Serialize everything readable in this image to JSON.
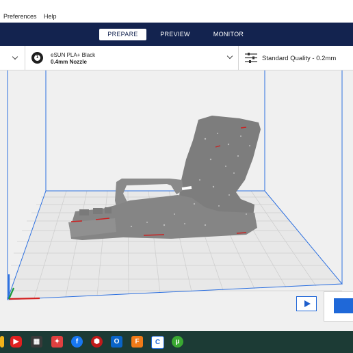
{
  "menu": {
    "preferences": "Preferences",
    "help": "Help"
  },
  "stages": {
    "prepare": "PREPARE",
    "preview": "PREVIEW",
    "monitor": "MONITOR",
    "active": "PREPARE"
  },
  "material": {
    "name": "eSUN PLA+ Black",
    "nozzle": "0.4mm Nozzle",
    "extruder_number": "1"
  },
  "quality": {
    "label": "Standard Quality - 0.2mm"
  },
  "colors": {
    "header_bg": "#13234f",
    "viewport_bg": "#f0f0f0",
    "build_plate": "#e7e7e7",
    "grid_line": "#cfcfcf",
    "volume_edges": "#2b6fe0",
    "model": "#8a8a8a",
    "accent": "#1f68d8",
    "taskbar": "#1c3b35"
  },
  "taskbar_icons": [
    "windows-start-icon",
    "youtube-icon",
    "calculator-icon",
    "red-app-icon",
    "facebook-icon",
    "red-hex-app-icon",
    "outlook-icon",
    "orange-f-app-icon",
    "cura-icon",
    "utorrent-icon"
  ]
}
